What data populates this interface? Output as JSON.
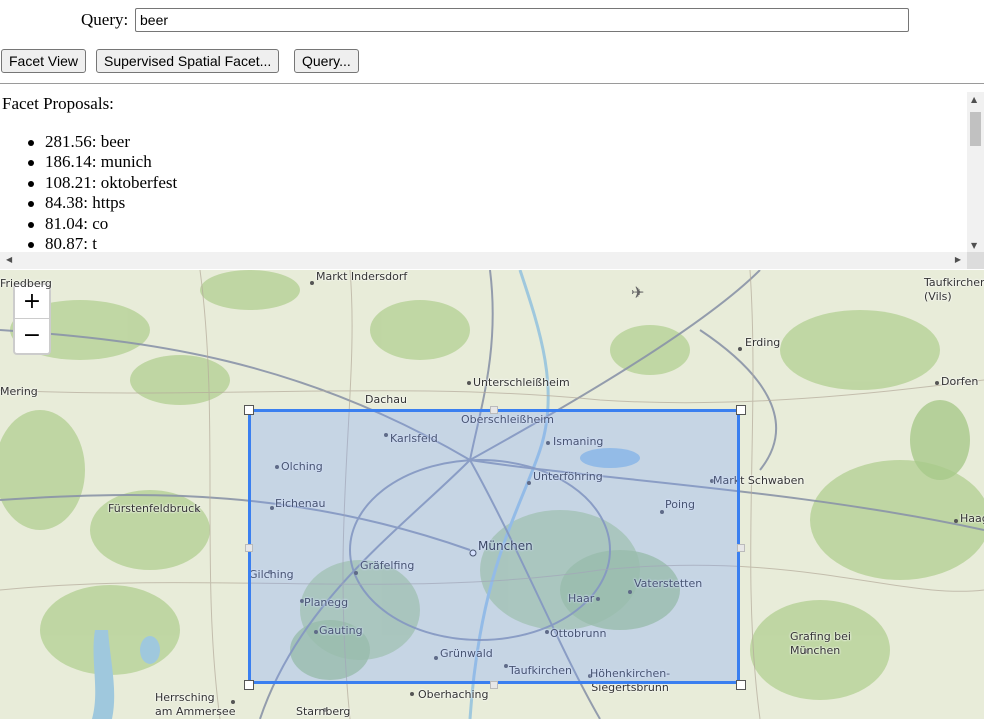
{
  "query": {
    "label": "Query:",
    "value": "beer"
  },
  "buttons": {
    "facet_view": "Facet View",
    "supervised": "Supervised Spatial Facet...",
    "query": "Query..."
  },
  "facets": {
    "title": "Facet Proposals:",
    "items": [
      {
        "text": "281.56: beer"
      },
      {
        "text": "186.14: munich"
      },
      {
        "text": "108.21: oktoberfest"
      },
      {
        "text": "84.38: https"
      },
      {
        "text": "81.04: co"
      },
      {
        "text": "80.87: t"
      }
    ]
  },
  "map": {
    "zoom_in": "+",
    "zoom_out": "−",
    "places": {
      "friedberg": "Friedberg",
      "markt_indersdorf": "Markt Indersdorf",
      "taufkirchen": "Taufkirchen\n(Vils)",
      "erding": "Erding",
      "mering": "Mering",
      "unterschleissheim": "Unterschleißheim",
      "dorfen": "Dorfen",
      "dachau": "Dachau",
      "oberschleissheim": "Oberschleißheim",
      "karlsfeld": "Karlsfeld",
      "ismaning": "Ismaning",
      "olching": "Olching",
      "unterfoehring": "Unterföhring",
      "markt_schwaben": "Markt Schwaben",
      "eichenau": "Eichenau",
      "fuerstenfeldbruck": "Fürstenfeldbruck",
      "poing": "Poing",
      "haag": "Haag",
      "muenchen": "München",
      "graefelfing": "Gräfelfing",
      "gilching": "Gilching",
      "vaterstetten": "Vaterstetten",
      "haar": "Haar",
      "planegg": "Planegg",
      "gauting": "Gauting",
      "ottobrunn": "Ottobrunn",
      "grafing": "Grafing bei\nMünchen",
      "gruenwald": "Grünwald",
      "taufkirchen2": "Taufkirchen",
      "hoehenkirchen": "Höhenkirchen-\nSiegertsbrunn",
      "herrsching": "Herrsching\nam Ammersee",
      "oberhaching": "Oberhaching",
      "starnberg": "Starnberg"
    }
  }
}
